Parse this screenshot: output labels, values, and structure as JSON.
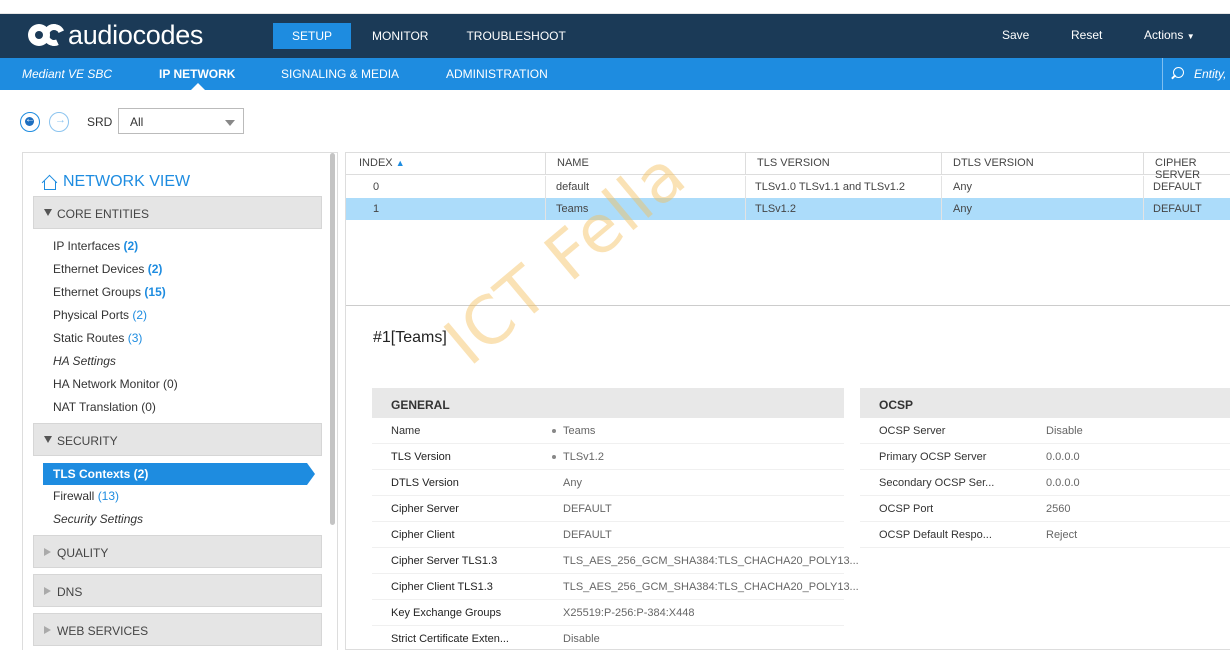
{
  "brand": {
    "logo_text": "audiocodes"
  },
  "top_nav": {
    "tabs": [
      {
        "label": "SETUP",
        "active": true
      },
      {
        "label": "MONITOR",
        "active": false
      },
      {
        "label": "TROUBLESHOOT",
        "active": false
      }
    ],
    "actions": {
      "save": "Save",
      "reset": "Reset",
      "actions": "Actions"
    }
  },
  "sub_nav": {
    "product": "Mediant VE SBC",
    "tabs": [
      {
        "label": "IP NETWORK",
        "active": true
      },
      {
        "label": "SIGNALING & MEDIA",
        "active": false
      },
      {
        "label": "ADMINISTRATION",
        "active": false
      }
    ],
    "search_text": "Entity,"
  },
  "toolbar": {
    "srd_label": "SRD",
    "srd_value": "All"
  },
  "network_view": {
    "title": "NETWORK VIEW",
    "sections": [
      {
        "label": "CORE ENTITIES",
        "expanded": true
      },
      {
        "label": "SECURITY",
        "expanded": true
      },
      {
        "label": "QUALITY",
        "expanded": false
      },
      {
        "label": "DNS",
        "expanded": false
      },
      {
        "label": "WEB SERVICES",
        "expanded": false
      }
    ],
    "core_items": [
      {
        "label": "IP Interfaces",
        "count": "(2)"
      },
      {
        "label": "Ethernet Devices",
        "count": "(2)"
      },
      {
        "label": "Ethernet Groups",
        "count": "(15)"
      },
      {
        "label": "Physical Ports",
        "count": "(2)"
      },
      {
        "label": "Static Routes",
        "count": "(3)"
      },
      {
        "label": "HA Settings",
        "count": ""
      },
      {
        "label": "HA Network Monitor (0)",
        "count": ""
      },
      {
        "label": "NAT Translation (0)",
        "count": ""
      }
    ],
    "security_items": [
      {
        "label": "TLS Contexts (2)",
        "active": true
      },
      {
        "label": "Firewall",
        "count": "(13)"
      },
      {
        "label": "Security Settings",
        "count": ""
      }
    ]
  },
  "table": {
    "columns": [
      "INDEX",
      "NAME",
      "TLS VERSION",
      "DTLS VERSION",
      "CIPHER SERVER"
    ],
    "rows": [
      [
        "0",
        "default",
        "TLSv1.0 TLSv1.1 and TLSv1.2",
        "Any",
        "DEFAULT"
      ],
      [
        "1",
        "Teams",
        "TLSv1.2",
        "Any",
        "DEFAULT"
      ]
    ]
  },
  "detail": {
    "title": "#1[Teams]",
    "general": {
      "heading": "GENERAL",
      "fields": [
        {
          "key": "Name",
          "value": "Teams"
        },
        {
          "key": "TLS Version",
          "value": "TLSv1.2"
        },
        {
          "key": "DTLS Version",
          "value": "Any"
        },
        {
          "key": "Cipher Server",
          "value": "DEFAULT"
        },
        {
          "key": "Cipher Client",
          "value": "DEFAULT"
        },
        {
          "key": "Cipher Server TLS1.3",
          "value": "TLS_AES_256_GCM_SHA384:TLS_CHACHA20_POLY13..."
        },
        {
          "key": "Cipher Client TLS1.3",
          "value": "TLS_AES_256_GCM_SHA384:TLS_CHACHA20_POLY13..."
        },
        {
          "key": "Key Exchange Groups",
          "value": "X25519:P-256:P-384:X448"
        },
        {
          "key": "Strict Certificate Exten...",
          "value": "Disable"
        }
      ]
    },
    "ocsp": {
      "heading": "OCSP",
      "fields": [
        {
          "key": "OCSP Server",
          "value": "Disable"
        },
        {
          "key": "Primary OCSP Server",
          "value": "0.0.0.0"
        },
        {
          "key": "Secondary OCSP Ser...",
          "value": "0.0.0.0"
        },
        {
          "key": "OCSP Port",
          "value": "2560"
        },
        {
          "key": "OCSP Default Respo...",
          "value": "Reject"
        }
      ]
    }
  },
  "watermark": "ICT Fella",
  "colors": {
    "header": "#1b3a57",
    "accent": "#1e8ce0",
    "selected_row": "#acdcfa"
  }
}
